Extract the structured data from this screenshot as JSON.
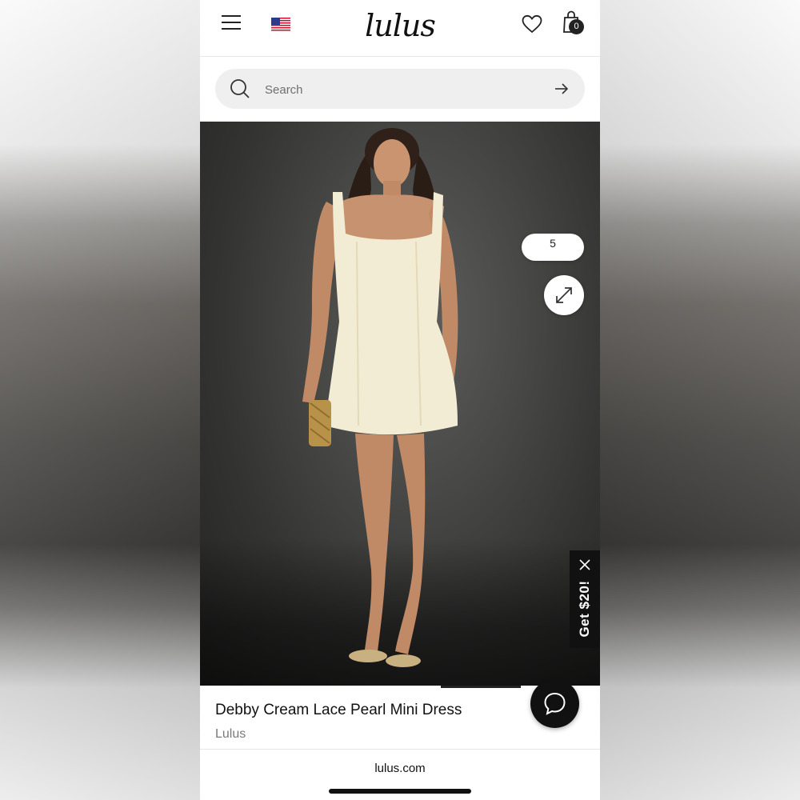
{
  "header": {
    "logo_text": "lulus",
    "cart_count": "0",
    "menu_icon": "hamburger-menu-icon",
    "flag_icon": "us-flag-icon",
    "wishlist_icon": "heart-icon",
    "cart_icon": "shopping-bag-icon"
  },
  "search": {
    "placeholder": "Search",
    "icon": "search-icon",
    "submit_icon": "arrow-right-icon"
  },
  "gallery": {
    "size_pill_label": "5",
    "expand_icon": "expand-icon"
  },
  "promo": {
    "label": "Get $20!",
    "close_icon": "close-icon"
  },
  "product": {
    "title": "Debby Cream Lace Pearl Mini Dress",
    "brand": "Lulus"
  },
  "chat": {
    "icon": "chat-bubble-icon"
  },
  "browser": {
    "url": "lulus.com"
  },
  "colors": {
    "text_primary": "#111111",
    "text_secondary": "#7a7a7a",
    "search_bg": "#efefef",
    "promo_bg": "#111111",
    "dress": "#f3ecd4"
  }
}
